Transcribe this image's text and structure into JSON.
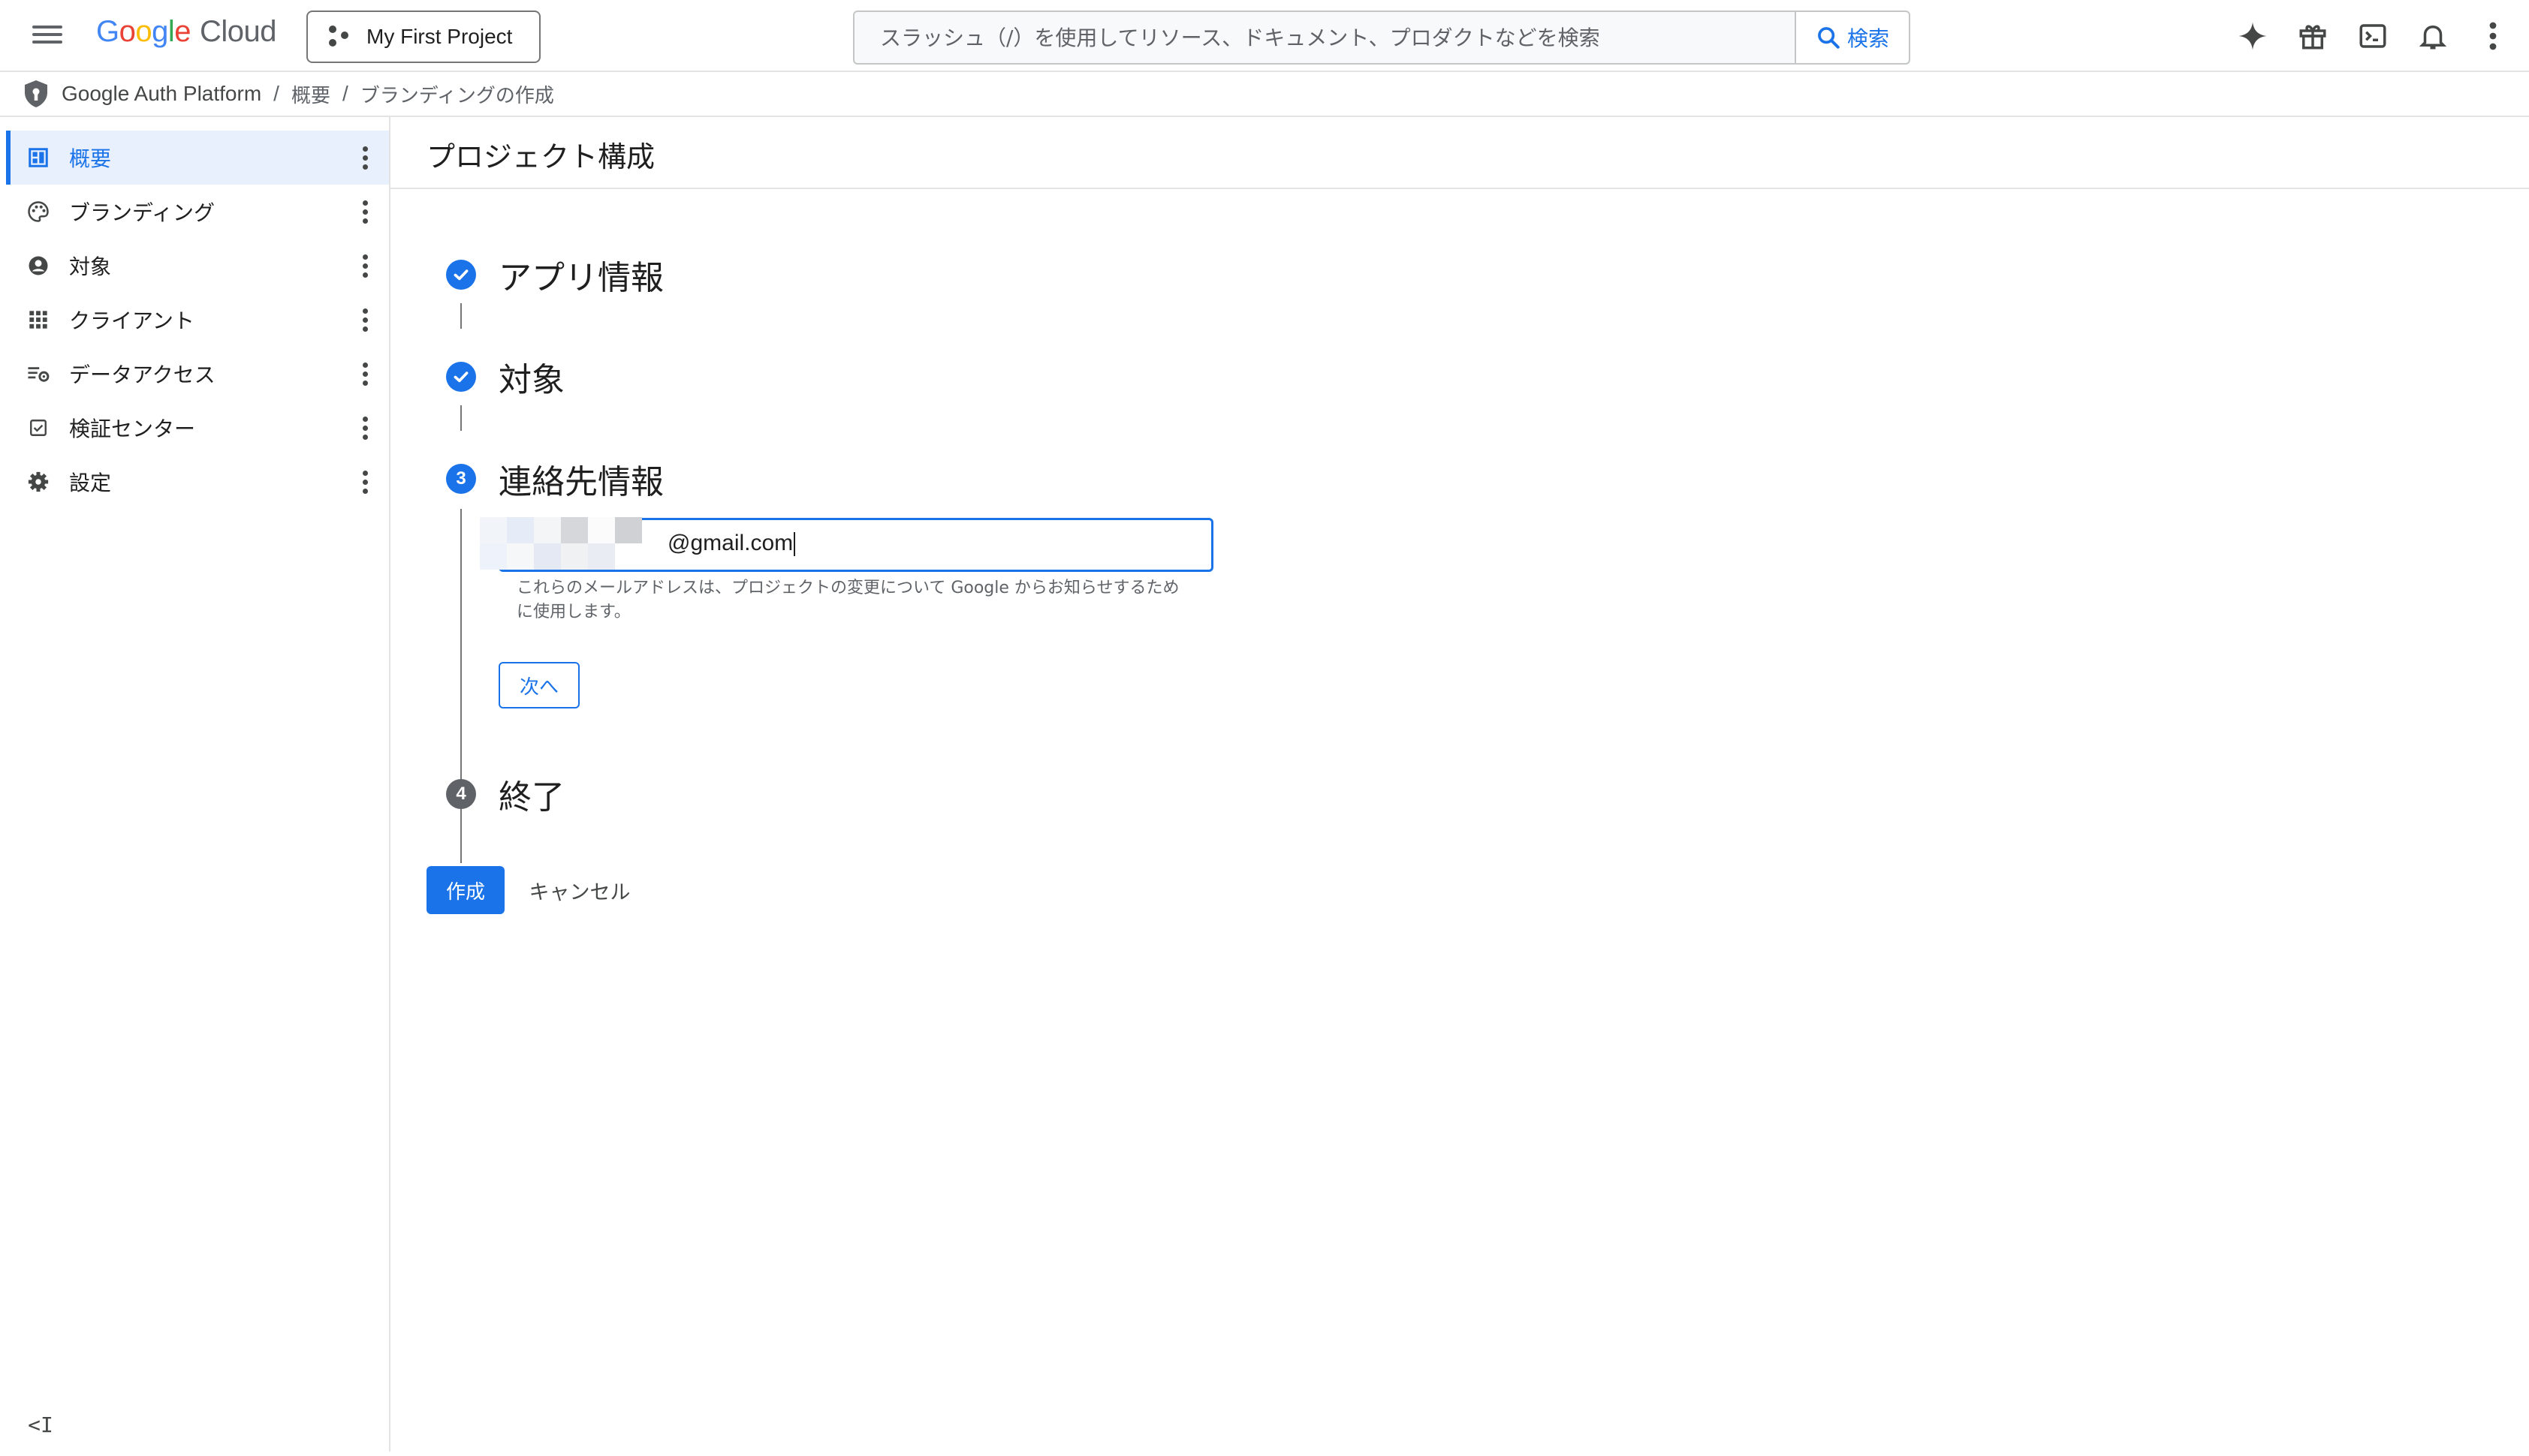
{
  "header": {
    "logo_google": "Google",
    "logo_cloud": "Cloud",
    "project": "My First Project",
    "search_placeholder": "スラッシュ（/）を使用してリソース、ドキュメント、プロダクトなどを検索",
    "search_button": "検索",
    "icons": [
      "gemini-icon",
      "gift-icon",
      "cloud-shell-icon",
      "notifications-icon",
      "more-vert-icon"
    ]
  },
  "breadcrumb": {
    "items": [
      "Google Auth Platform",
      "概要",
      "ブランディングの作成"
    ],
    "separator": "/"
  },
  "sidebar": {
    "items": [
      {
        "label": "概要",
        "icon": "dashboard-icon",
        "active": true
      },
      {
        "label": "ブランディング",
        "icon": "palette-icon",
        "active": false
      },
      {
        "label": "対象",
        "icon": "account-circle-icon",
        "active": false
      },
      {
        "label": "クライアント",
        "icon": "apps-grid-icon",
        "active": false
      },
      {
        "label": "データアクセス",
        "icon": "data-access-icon",
        "active": false
      },
      {
        "label": "検証センター",
        "icon": "verification-icon",
        "active": false
      },
      {
        "label": "設定",
        "icon": "settings-gear-icon",
        "active": false
      }
    ],
    "collapse_label": "<I"
  },
  "main": {
    "title": "プロジェクト構成",
    "steps": [
      {
        "number": "1",
        "title": "アプリ情報",
        "state": "done"
      },
      {
        "number": "2",
        "title": "対象",
        "state": "done"
      },
      {
        "number": "3",
        "title": "連絡先情報",
        "state": "current"
      },
      {
        "number": "4",
        "title": "終了",
        "state": "pending"
      }
    ],
    "email_value": "@gmail.com",
    "email_helper": "これらのメールアドレスは、プロジェクトの変更について Google からお知らせするために使用します。",
    "next_button": "次へ",
    "create_button": "作成",
    "cancel_button": "キャンセル"
  },
  "colors": {
    "accent": "#1a73e8",
    "active_bg": "#e8f0fe",
    "text": "#1f1f1f",
    "muted": "#5f6368"
  }
}
